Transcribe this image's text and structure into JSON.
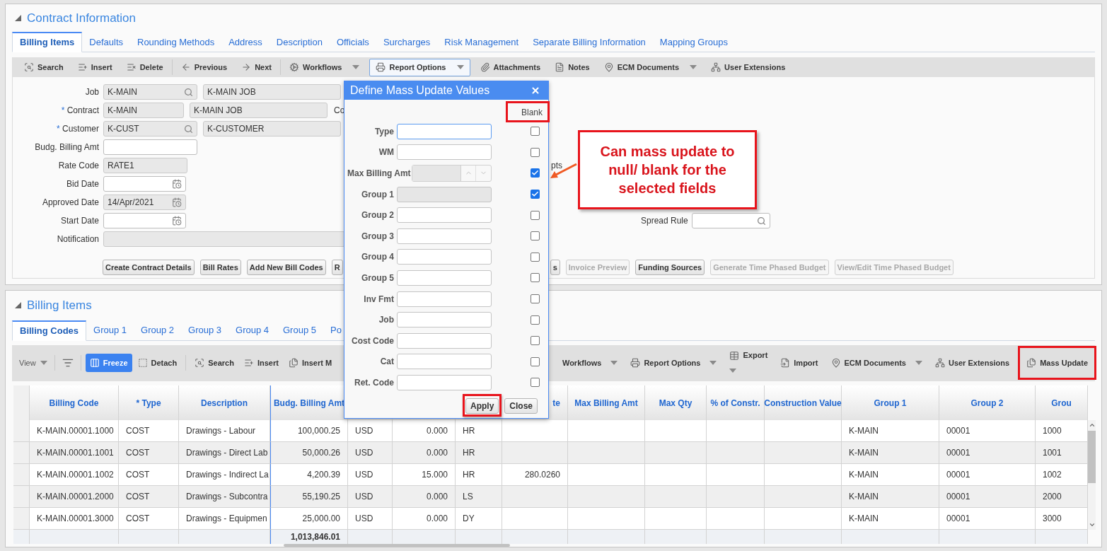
{
  "top_panel": {
    "title": "Contract Information",
    "tabs": [
      {
        "label": "Billing Items",
        "selected": true
      },
      {
        "label": "Defaults",
        "selected": false
      },
      {
        "label": "Rounding Methods",
        "selected": false
      },
      {
        "label": "Address",
        "selected": false
      },
      {
        "label": "Description",
        "selected": false
      },
      {
        "label": "Officials",
        "selected": false
      },
      {
        "label": "Surcharges",
        "selected": false
      },
      {
        "label": "Risk Management",
        "selected": false
      },
      {
        "label": "Separate Billing Information",
        "selected": false
      },
      {
        "label": "Mapping Groups",
        "selected": false
      }
    ],
    "toolbar_groups": [
      [
        {
          "label": "Search",
          "dropdown": false,
          "focused": false
        },
        {
          "label": "Insert",
          "dropdown": false,
          "focused": false
        },
        {
          "label": "Delete",
          "dropdown": false,
          "focused": false
        }
      ],
      [
        {
          "label": "Previous",
          "dropdown": false,
          "focused": false
        },
        {
          "label": "Next",
          "dropdown": false,
          "focused": false
        }
      ],
      [
        {
          "label": "Workflows",
          "dropdown": true,
          "focused": false
        },
        {
          "label": "Report Options",
          "dropdown": true,
          "focused": true
        },
        {
          "label": "Attachments",
          "dropdown": false,
          "focused": false
        },
        {
          "label": "Notes",
          "dropdown": false,
          "focused": false
        },
        {
          "label": "ECM Documents",
          "dropdown": true,
          "focused": false
        },
        {
          "label": "User Extensions",
          "dropdown": false,
          "focused": false
        }
      ]
    ],
    "form_rows": [
      {
        "label": "Job",
        "fields": [
          {
            "kind": "lookup",
            "value": "K-MAIN",
            "disabled": true
          },
          {
            "kind": "text",
            "value": "K-MAIN JOB",
            "disabled": true
          }
        ]
      },
      {
        "label": "Contract",
        "required_mark": "*",
        "fields": [
          {
            "kind": "text",
            "value": "K-MAIN",
            "disabled": true
          },
          {
            "kind": "text",
            "value": "K-MAIN JOB",
            "disabled": true
          }
        ],
        "trailing": {
          "label": "Co"
        }
      },
      {
        "label": "Customer",
        "required_mark": "*",
        "fields": [
          {
            "kind": "lookup",
            "value": "K-CUST",
            "disabled": true
          },
          {
            "kind": "text",
            "value": "K-CUSTOMER",
            "disabled": true
          }
        ]
      },
      {
        "label": "Budg. Billing Amt",
        "fields": [
          {
            "kind": "text",
            "disabled": false
          }
        ]
      },
      {
        "label": "Rate Code",
        "fields": [
          {
            "kind": "text",
            "value": "RATE1",
            "disabled": true
          }
        ],
        "trailing": {
          "label": "pts"
        }
      },
      {
        "label": "Bid Date",
        "fields": [
          {
            "kind": "date",
            "disabled": false
          }
        ]
      },
      {
        "label": "Approved Date",
        "fields": [
          {
            "kind": "date",
            "value": "14/Apr/2021",
            "disabled": true
          }
        ]
      },
      {
        "label": "Start Date",
        "fields": [
          {
            "kind": "date",
            "disabled": false
          }
        ],
        "trailing": {
          "label": "Spread Rule",
          "field": {
            "kind": "lookup",
            "disabled": false
          }
        }
      },
      {
        "label": "Notification",
        "fields": [
          {
            "kind": "text",
            "disabled": true
          }
        ]
      }
    ],
    "buttons_left": [
      {
        "label": "Create Contract Details",
        "disabled": false
      },
      {
        "label": "Bill Rates",
        "disabled": false
      },
      {
        "label": "Add New Bill Codes",
        "disabled": false
      },
      {
        "label": "R",
        "disabled": false
      }
    ],
    "buttons_right": [
      {
        "label": "s",
        "disabled": false
      },
      {
        "label": "Invoice Preview",
        "disabled": true
      },
      {
        "label": "Funding Sources",
        "disabled": false
      },
      {
        "label": "Generate Time Phased Budget",
        "disabled": true
      },
      {
        "label": "View/Edit Time Phased Budget",
        "disabled": true
      }
    ]
  },
  "callout": {
    "text": "Can mass update to null/ blank for the selected fields"
  },
  "dialog": {
    "title": "Define Mass Update Values",
    "blank_header": "Blank",
    "blank_header_highlighted": true,
    "fields": [
      {
        "label": "Type",
        "kind": "text",
        "disabled": false,
        "focused": true,
        "blank": false
      },
      {
        "label": "WM",
        "kind": "text",
        "disabled": false,
        "focused": false,
        "blank": false
      },
      {
        "label": "Max Billing Amt",
        "kind": "number",
        "disabled": true,
        "focused": false,
        "blank": true
      },
      {
        "label": "Group 1",
        "kind": "text",
        "disabled": true,
        "focused": false,
        "blank": true
      },
      {
        "label": "Group 2",
        "kind": "text",
        "disabled": false,
        "focused": false,
        "blank": false
      },
      {
        "label": "Group 3",
        "kind": "text",
        "disabled": false,
        "focused": false,
        "blank": false
      },
      {
        "label": "Group 4",
        "kind": "text",
        "disabled": false,
        "focused": false,
        "blank": false
      },
      {
        "label": "Group 5",
        "kind": "text",
        "disabled": false,
        "focused": false,
        "blank": false
      },
      {
        "label": "Inv Fmt",
        "kind": "text",
        "disabled": false,
        "focused": false,
        "blank": false
      },
      {
        "label": "Job",
        "kind": "text",
        "disabled": false,
        "focused": false,
        "blank": false
      },
      {
        "label": "Cost Code",
        "kind": "text",
        "disabled": false,
        "focused": false,
        "blank": false
      },
      {
        "label": "Cat",
        "kind": "text",
        "disabled": false,
        "focused": false,
        "blank": false
      },
      {
        "label": "Ret. Code",
        "kind": "text",
        "disabled": false,
        "focused": false,
        "blank": false
      }
    ],
    "buttons": [
      {
        "label": "Apply",
        "highlighted": true
      },
      {
        "label": "Close",
        "highlighted": false
      }
    ]
  },
  "bottom_panel": {
    "title": "Billing Items",
    "tabs": [
      {
        "label": "Billing Codes",
        "selected": true
      },
      {
        "label": "Group 1",
        "selected": false
      },
      {
        "label": "Group 2",
        "selected": false
      },
      {
        "label": "Group 3",
        "selected": false
      },
      {
        "label": "Group 4",
        "selected": false
      },
      {
        "label": "Group 5",
        "selected": false
      },
      {
        "label": "Po",
        "selected": false
      }
    ],
    "toolbar_left_groups": [
      [
        {
          "label": "View",
          "kind": "dropdown"
        }
      ],
      [
        {
          "label": "Freeze",
          "kind": "primary"
        },
        {
          "label": "Detach",
          "kind": "plain"
        }
      ],
      [
        {
          "label": "Search",
          "kind": "plain"
        },
        {
          "label": "Insert",
          "kind": "plain"
        },
        {
          "label": "Insert M",
          "kind": "plain"
        }
      ]
    ],
    "toolbar_right": [
      {
        "label": "Workflows",
        "kind": "dropdown",
        "highlighted": false
      },
      {
        "label": "Report Options",
        "kind": "dropdown",
        "highlighted": false
      },
      {
        "label": "Export",
        "kind": "stacked",
        "highlighted": false
      },
      {
        "label": "Import",
        "kind": "plain",
        "highlighted": false
      },
      {
        "label": "ECM Documents",
        "kind": "dropdown",
        "highlighted": false
      },
      {
        "label": "User Extensions",
        "kind": "plain",
        "highlighted": false
      },
      {
        "label": "Mass Update",
        "kind": "plain",
        "highlighted": true
      }
    ],
    "table": {
      "columns": [
        {
          "label": "Billing Code"
        },
        {
          "label": "* Type"
        },
        {
          "label": "Description"
        },
        {
          "label": "Budg. Billing Amt"
        },
        {},
        {},
        {},
        {
          "label": "te"
        },
        {
          "label": "Max Billing Amt"
        },
        {
          "label": "Max Qty"
        },
        {
          "label": "% of Constr."
        },
        {
          "label": "Construction Value"
        },
        {
          "label": "Group 1"
        },
        {
          "label": "Group 2"
        },
        {
          "label": "Grou"
        }
      ],
      "rows": [
        {
          "billing_code": "K-MAIN.00001.1000",
          "type": "COST",
          "description": "Drawings - Labour",
          "budg_billing_amt": "100,000.25",
          "column_5": "USD",
          "column_6": "0.000",
          "column_7": "HR",
          "group_1": "K-MAIN",
          "group_2": "00001",
          "column_15": "1000"
        },
        {
          "billing_code": "K-MAIN.00001.1001",
          "type": "COST",
          "description": "Drawings - Direct Lab",
          "budg_billing_amt": "50,000.26",
          "column_5": "USD",
          "column_6": "0.000",
          "column_7": "HR",
          "group_1": "K-MAIN",
          "group_2": "00001",
          "column_15": "1001"
        },
        {
          "billing_code": "K-MAIN.00001.1002",
          "type": "COST",
          "description": "Drawings - Indirect La",
          "budg_billing_amt": "4,200.39",
          "column_5": "USD",
          "column_6": "15.000",
          "column_7": "HR",
          "column_8": "280.0260",
          "group_1": "K-MAIN",
          "group_2": "00001",
          "column_15": "1002"
        },
        {
          "billing_code": "K-MAIN.00001.2000",
          "type": "COST",
          "description": "Drawings - Subcontra",
          "budg_billing_amt": "55,190.25",
          "column_5": "USD",
          "column_6": "0.000",
          "column_7": "LS",
          "group_1": "K-MAIN",
          "group_2": "00001",
          "column_15": "2000"
        },
        {
          "billing_code": "K-MAIN.00001.3000",
          "type": "COST",
          "description": "Drawings - Equipmen",
          "budg_billing_amt": "25,000.00",
          "column_5": "USD",
          "column_6": "0.000",
          "column_7": "DY",
          "group_1": "K-MAIN",
          "group_2": "00001",
          "column_15": "3000"
        }
      ],
      "totals": {
        "budg_billing_amt": "1,013,846.01"
      }
    }
  }
}
